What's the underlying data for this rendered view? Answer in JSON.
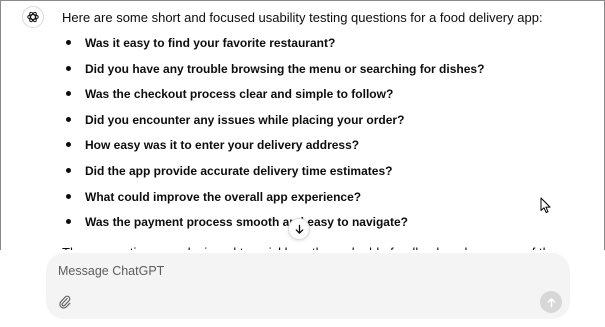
{
  "message": {
    "avatar_icon": "chatgpt-logo-icon",
    "intro": "Here are some short and focused usability testing questions for a food delivery app:",
    "questions": [
      "Was it easy to find your favorite restaurant?",
      "Did you have any trouble browsing the menu or searching for dishes?",
      "Was the checkout process clear and simple to follow?",
      "Did you encounter any issues while placing your order?",
      "How easy was it to enter your delivery address?",
      "Did the app provide accurate delivery time estimates?",
      "What could improve the overall app experience?",
      "Was the payment process smooth and easy to navigate?"
    ],
    "outro": "These questions are designed to quickly gather valuable feedback on key areas of the app's"
  },
  "scroll_down_icon": "arrow-down-icon",
  "composer": {
    "placeholder": "Message ChatGPT",
    "value": "",
    "attach_icon": "paperclip-icon",
    "send_icon": "arrow-up-icon"
  },
  "colors": {
    "text": "#0d0d0d",
    "composer_bg": "#f4f4f4",
    "send_disabled_bg": "#d7d7d7"
  }
}
